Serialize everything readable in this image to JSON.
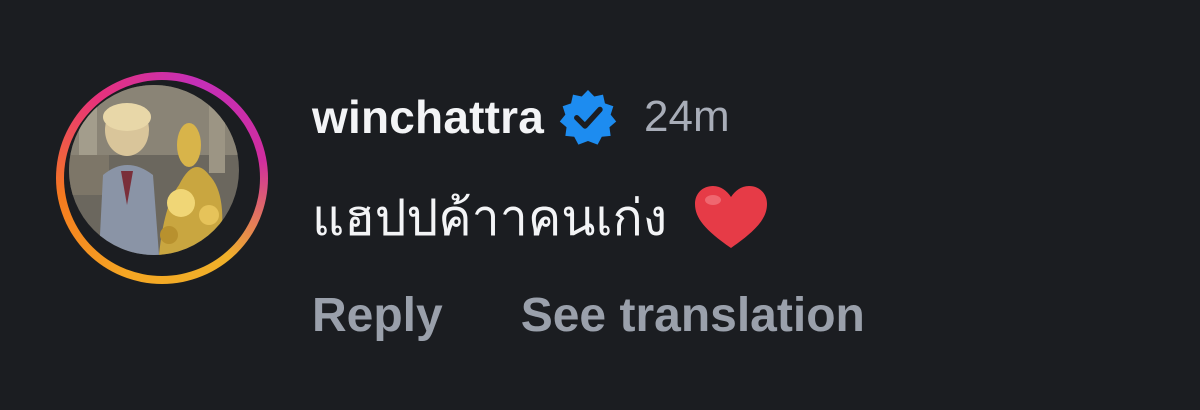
{
  "comment": {
    "author": "winchattra",
    "verified": true,
    "timestamp": "24m",
    "text": "แฮปปค้าาคนเก่ง",
    "emoji": "red-heart-icon",
    "actions": {
      "reply_label": "Reply",
      "translate_label": "See translation"
    }
  },
  "colors": {
    "background": "#1b1d21",
    "verified_badge": "#1d8cf0",
    "heart": "#e63b47",
    "action_text": "#9aa0ab",
    "timestamp_text": "#a8adb8"
  }
}
